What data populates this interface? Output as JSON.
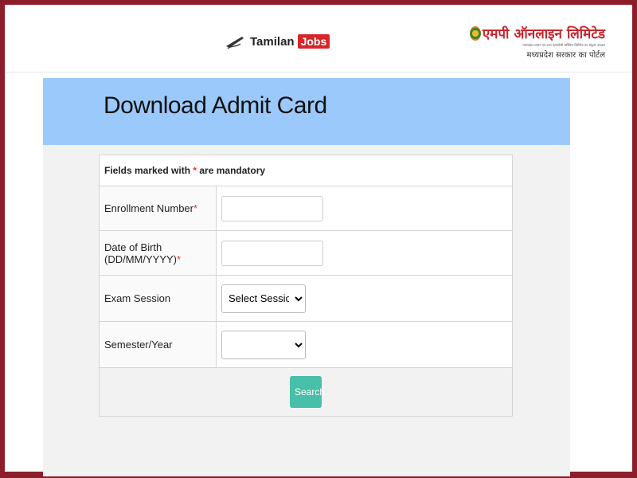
{
  "header": {
    "tamilan_name": "Tamilan",
    "tamilan_jobs": "Jobs",
    "mp_brand": "एमपी ऑनलाइन लिमिटेड",
    "mp_tagline_small": "मध्यप्रदेश शासन एवं टाटा कंसल्टेंसी सर्विसेज लिमिटेड का संयुक्त उपक्रम",
    "mp_tagline": "मध्यप्रदेश सरकार का पोर्टल"
  },
  "page": {
    "title": "Download Admit Card"
  },
  "form": {
    "mandatory_note_prefix": "Fields marked with ",
    "mandatory_star": "*",
    "mandatory_note_suffix": " are mandatory",
    "enrollment_label": "Enrollment Number",
    "enrollment_value": "",
    "dob_label": "Date of Birth (DD/MM/YYYY)",
    "dob_value": "",
    "exam_session_label": "Exam Session",
    "exam_session_selected": "Select Session",
    "semester_label": "Semester/Year",
    "semester_selected": "",
    "search_label": "Search"
  },
  "colors": {
    "border": "#8b1e2a",
    "header_band": "#9cc9fb",
    "search_button": "#48bfa9",
    "required_star": "#e33"
  }
}
